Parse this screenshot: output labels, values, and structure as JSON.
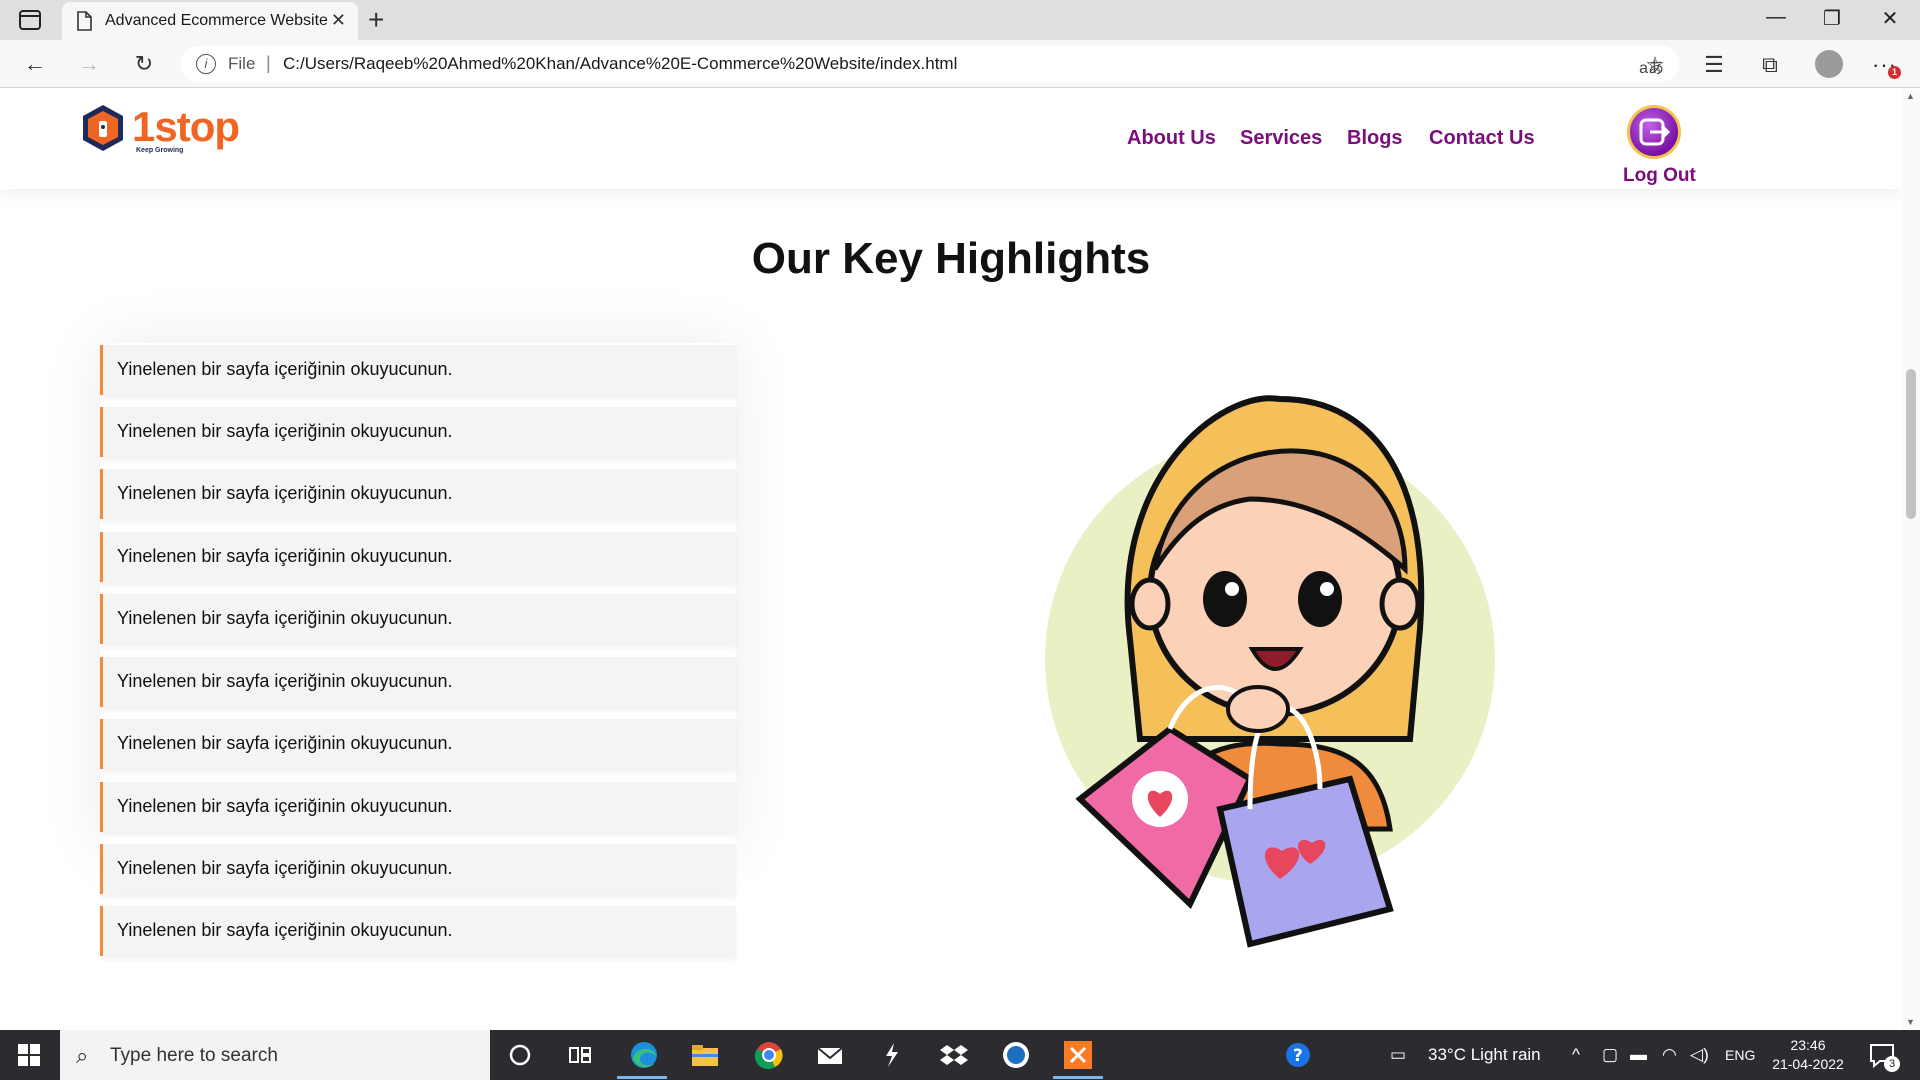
{
  "browser": {
    "tab_title": "Advanced Ecommerce Website",
    "address_prefix": "File",
    "url": "C:/Users/Raqeeb%20Ahmed%20Khan/Advance%20E-Commerce%20Website/index.html",
    "notification_count": "1"
  },
  "site": {
    "logo_text": "1stop",
    "logo_tagline": "Keep Growing",
    "nav": [
      "About Us",
      "Services",
      "Blogs",
      "Contact Us"
    ],
    "logout_label": "Log Out",
    "section_title": "Our Key Highlights",
    "highlights": [
      "Yinelenen bir sayfa içeriğinin okuyucunun.",
      "Yinelenen bir sayfa içeriğinin okuyucunun.",
      "Yinelenen bir sayfa içeriğinin okuyucunun.",
      "Yinelenen bir sayfa içeriğinin okuyucunun.",
      "Yinelenen bir sayfa içeriğinin okuyucunun.",
      "Yinelenen bir sayfa içeriğinin okuyucunun.",
      "Yinelenen bir sayfa içeriğinin okuyucunun.",
      "Yinelenen bir sayfa içeriğinin okuyucunun.",
      "Yinelenen bir sayfa içeriğinin okuyucunun.",
      "Yinelenen bir sayfa içeriğinin okuyucunun."
    ],
    "accent_color": "#f08a3c",
    "nav_color": "#7b0d7d"
  },
  "taskbar": {
    "search_placeholder": "Type here to search",
    "weather": "33°C  Light rain",
    "language": "ENG",
    "time": "23:46",
    "date": "21-04-2022",
    "notifications": "3"
  }
}
